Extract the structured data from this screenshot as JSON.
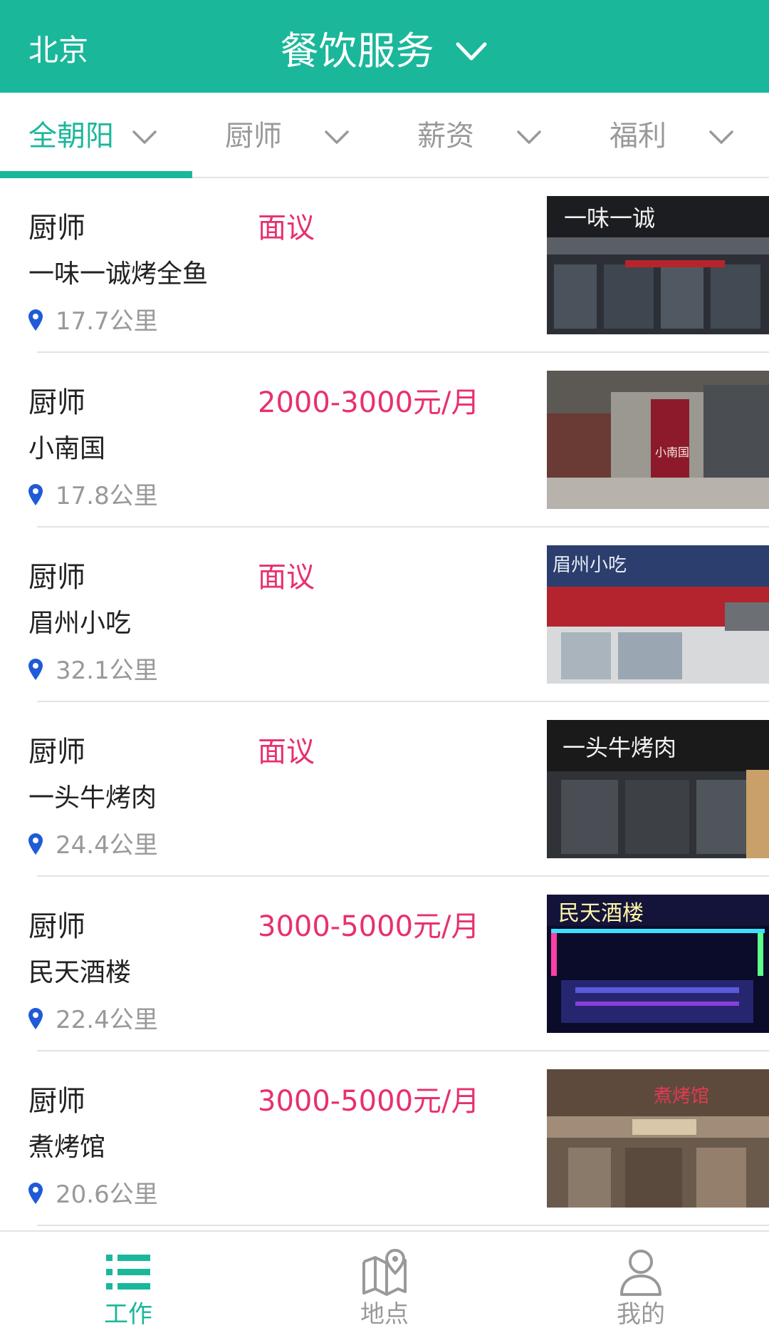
{
  "header": {
    "city": "北京",
    "title": "餐饮服务",
    "title_icon": "chevron-down-icon",
    "background_color": "#1bb79a"
  },
  "filters": [
    {
      "label": "全朝阳",
      "active": true
    },
    {
      "label": "厨师",
      "active": false
    },
    {
      "label": "薪资",
      "active": false
    },
    {
      "label": "福利",
      "active": false
    }
  ],
  "jobs": [
    {
      "title": "厨师",
      "salary": "面议",
      "shop": "一味一诚烤全鱼",
      "distance": "17.7公里",
      "sign": "一味一诚"
    },
    {
      "title": "厨师",
      "salary": "2000-3000元/月",
      "shop": "小南国",
      "distance": "17.8公里",
      "sign": "小南国"
    },
    {
      "title": "厨师",
      "salary": "面议",
      "shop": "眉州小吃",
      "distance": "32.1公里",
      "sign": "眉州小吃"
    },
    {
      "title": "厨师",
      "salary": "面议",
      "shop": "一头牛烤肉",
      "distance": "24.4公里",
      "sign": "一头牛烤肉"
    },
    {
      "title": "厨师",
      "salary": "3000-5000元/月",
      "shop": "民天酒楼",
      "distance": "22.4公里",
      "sign": "民天酒楼"
    },
    {
      "title": "厨师",
      "salary": "3000-5000元/月",
      "shop": "煮烤馆",
      "distance": "20.6公里",
      "sign": "煮烤馆"
    }
  ],
  "bottom_nav": [
    {
      "label": "工作",
      "icon": "list-icon",
      "active": true
    },
    {
      "label": "地点",
      "icon": "map-pin-icon",
      "active": false
    },
    {
      "label": "我的",
      "icon": "user-icon",
      "active": false
    }
  ],
  "colors": {
    "accent": "#1bb79a",
    "salary": "#e8306e",
    "secondary_text": "#999999",
    "pin": "#1f5bd6"
  }
}
